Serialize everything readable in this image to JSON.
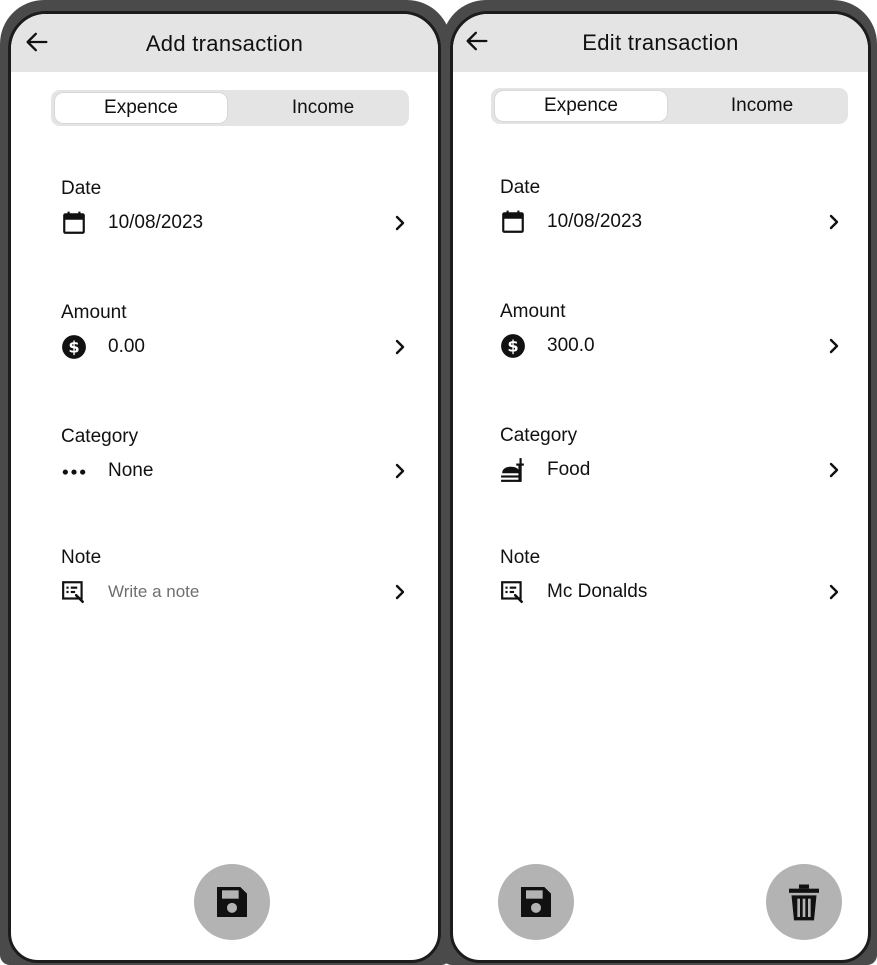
{
  "screens": {
    "add": {
      "title": "Add transaction",
      "tabs": {
        "expense": "Expence",
        "income": "Income"
      },
      "fields": {
        "date": {
          "label": "Date",
          "value": "10/08/2023"
        },
        "amount": {
          "label": "Amount",
          "value": "0.00"
        },
        "category": {
          "label": "Category",
          "value": "None"
        },
        "note": {
          "label": "Note",
          "placeholder": "Write a note"
        }
      },
      "icons": {
        "back": "arrow-left-icon",
        "date": "calendar-icon",
        "amount": "dollar-circle-icon",
        "category": "more-horizontal-icon",
        "note": "note-edit-icon",
        "chevron": "chevron-right-icon",
        "save": "save-icon"
      }
    },
    "edit": {
      "title": "Edit transaction",
      "tabs": {
        "expense": "Expence",
        "income": "Income"
      },
      "fields": {
        "date": {
          "label": "Date",
          "value": "10/08/2023"
        },
        "amount": {
          "label": "Amount",
          "value": "300.0"
        },
        "category": {
          "label": "Category",
          "value": "Food"
        },
        "note": {
          "label": "Note",
          "value": "Mc Donalds"
        }
      },
      "icons": {
        "back": "arrow-left-icon",
        "date": "calendar-icon",
        "amount": "dollar-circle-icon",
        "category": "fastfood-icon",
        "note": "note-edit-icon",
        "chevron": "chevron-right-icon",
        "save": "save-icon",
        "delete": "trash-icon"
      }
    }
  },
  "colors": {
    "app_bar": "#e4e4e4",
    "segment_track": "#e4e4e4",
    "segment_selected": "#ffffff",
    "fab": "#b3b3b3",
    "bezel": "#4a4a4a",
    "text": "#111111",
    "placeholder": "#6f6f6f"
  }
}
